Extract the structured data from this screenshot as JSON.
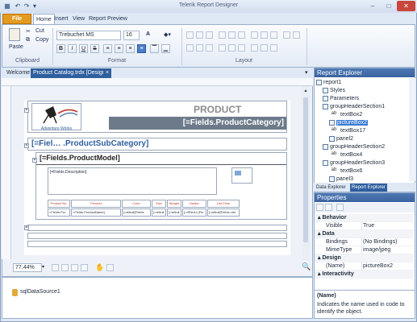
{
  "window": {
    "title": "Telerik Report Designer"
  },
  "ribbon_tabs": {
    "file": "File",
    "home": "Home",
    "insert": "Insert",
    "view": "View",
    "preview": "Report Preview"
  },
  "clipboard": {
    "paste": "Paste",
    "cut": "Cut",
    "copy": "Copy",
    "group_label": "Clipboard"
  },
  "format": {
    "font_name": "Trebuchet MS",
    "font_size": "16",
    "bold": "B",
    "italic": "I",
    "underline": "U",
    "strike": "S",
    "grow": "A",
    "shrink": "A",
    "group_label": "Format"
  },
  "layout": {
    "group_label": "Layout"
  },
  "doc_tabs": {
    "welcome": "Welcome",
    "active": "Product Catalog.trdx [Design]",
    "close": "×"
  },
  "report": {
    "logo_text": "Adventure Works",
    "title": "PRODUCT CATALOG",
    "category_field": "[=Fields.ProductCategory]",
    "subcategory_field": "[=Fiel… .ProductSubCategory]",
    "model_field": "[=Fields.ProductModel]",
    "description_field": "[=Fields.Description]",
    "table_headers": [
      "Product No.",
      "Product",
      "Color",
      "Size",
      "Weight",
      "Dealer",
      "List Price"
    ],
    "table_cells": [
      "=Fields.Pro",
      "=Fields.ProductName]",
      "[=IsNull(Fields.",
      "[=IsNull",
      "[=IsNull",
      "[=ISNULL(Fie",
      "[=IsNull(Fields.List"
    ]
  },
  "zoom": {
    "value": "77.44%"
  },
  "components": {
    "datasource": "sqlDataSource1"
  },
  "report_explorer": {
    "title": "Report Explorer",
    "items": [
      "report1",
      "Styles",
      "Parameters",
      "groupHeaderSection1",
      "textBox2",
      "pictureBox2",
      "textBox17",
      "panel2",
      "groupHeaderSection2",
      "textBox4",
      "groupHeaderSection3",
      "textBox6",
      "panel3"
    ],
    "tabs": [
      "Data Explorer",
      "Report Explorer"
    ]
  },
  "properties": {
    "title": "Properties",
    "rows": [
      {
        "cat": "Behavior"
      },
      {
        "name": "Visible",
        "value": "True"
      },
      {
        "cat": "Data"
      },
      {
        "name": "Bindings",
        "value": "(No Bindings)"
      },
      {
        "name": "MimeType",
        "value": "image/jpeg"
      },
      {
        "cat": "Design"
      },
      {
        "name": "(Name)",
        "value": "pictureBox2"
      },
      {
        "cat": "Interactivity"
      }
    ],
    "desc_title": "(Name)",
    "desc_text": "Indicates the name used in code to identify the object."
  },
  "colors": {
    "accent": "#3b7bd4",
    "file_tab": "#e49b1f",
    "title_gray": "#8c8c8c",
    "header_band": "#6d7a8a",
    "table_header_text": "#c0392b"
  }
}
